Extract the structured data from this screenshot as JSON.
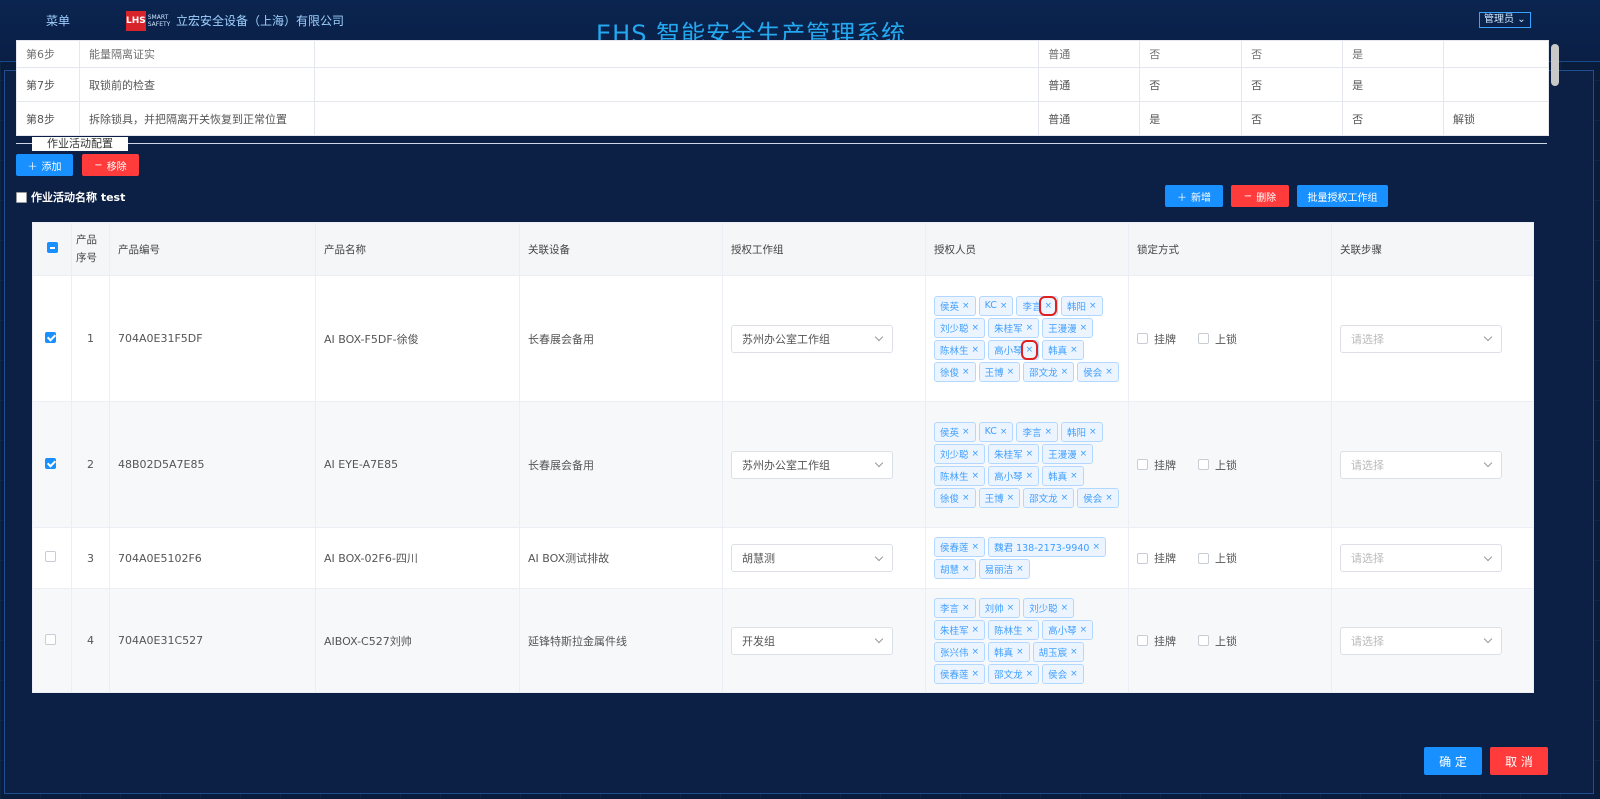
{
  "header": {
    "menu_label": "菜单",
    "company": "立宏安全设备（上海）有限公司",
    "logo_text": "LHS",
    "system_title": "EHS 智能安全生产管理系统",
    "user_menu": "管理员"
  },
  "steps": [
    {
      "no": "第6步",
      "desc": "能量隔离证实",
      "level": "普通",
      "c1": "否",
      "c2": "否",
      "c3": "是",
      "c4": ""
    },
    {
      "no": "第7步",
      "desc": "取锁前的检查",
      "level": "普通",
      "c1": "否",
      "c2": "否",
      "c3": "是",
      "c4": ""
    },
    {
      "no": "第8步",
      "desc": "拆除锁具，并把隔离开关恢复到正常位置",
      "level": "普通",
      "c1": "是",
      "c2": "否",
      "c3": "否",
      "c4": "解锁"
    }
  ],
  "section_title": "作业活动配置",
  "toolbar": {
    "add": "添加",
    "remove": "移除"
  },
  "activity_name": "作业活动名称 test",
  "grid_toolbar": {
    "new": "新增",
    "delete": "删除",
    "batch": "批量授权工作组"
  },
  "columns": {
    "seq": "产品序号",
    "code": "产品编号",
    "name": "产品名称",
    "device": "关联设备",
    "group": "授权工作组",
    "people": "授权人员",
    "lock": "锁定方式",
    "step": "关联步骤"
  },
  "lock_options": {
    "tag": "挂牌",
    "lock": "上锁"
  },
  "step_placeholder": "请选择",
  "rows": [
    {
      "seq": "1",
      "code": "704A0E31F5DF",
      "name": "AI BOX-F5DF-徐俊",
      "device": "长春展会备用",
      "group": "苏州办公室工作组",
      "checked": true,
      "people": [
        "侯英",
        "KC",
        "李言",
        "韩阳",
        "刘少聪",
        "朱桂军",
        "王漫漫",
        "陈林生",
        "高小琴",
        "韩真",
        "徐俊",
        "王博",
        "邵文龙",
        "侯会"
      ]
    },
    {
      "seq": "2",
      "code": "48B02D5A7E85",
      "name": "AI EYE-A7E85",
      "device": "长春展会备用",
      "group": "苏州办公室工作组",
      "checked": true,
      "people": [
        "侯英",
        "KC",
        "李言",
        "韩阳",
        "刘少聪",
        "朱桂军",
        "王漫漫",
        "陈林生",
        "高小琴",
        "韩真",
        "徐俊",
        "王博",
        "邵文龙",
        "侯会"
      ]
    },
    {
      "seq": "3",
      "code": "704A0E5102F6",
      "name": "AI BOX-02F6-四川",
      "device": "AI BOX测试排故",
      "group": "胡慧测",
      "checked": false,
      "people": [
        "侯春莲",
        "魏君 138-2173-9940",
        "胡慧",
        "易丽洁"
      ]
    },
    {
      "seq": "4",
      "code": "704A0E31C527",
      "name": "AIBOX-C527刘帅",
      "device": "延锋特斯拉金属件线",
      "group": "开发组",
      "checked": false,
      "people": [
        "李言",
        "刘帅",
        "刘少聪",
        "朱桂军",
        "陈林生",
        "高小琴",
        "张兴伟",
        "韩真",
        "胡玉宸",
        "侯春莲",
        "邵文龙",
        "侯会"
      ]
    }
  ],
  "footer": {
    "ok": "确 定",
    "cancel": "取 消"
  }
}
